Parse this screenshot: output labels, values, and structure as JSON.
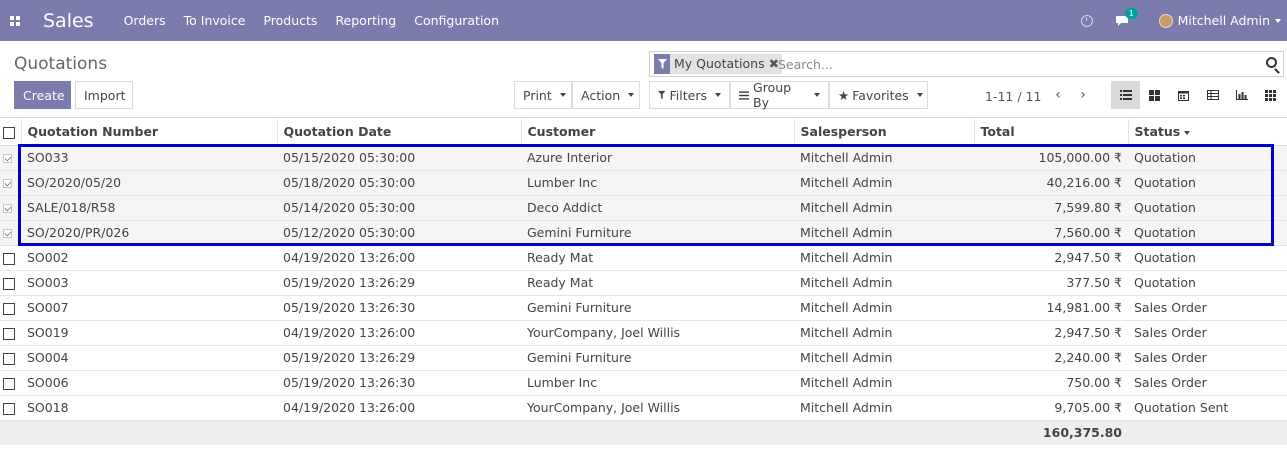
{
  "topbar": {
    "app_name": "Sales",
    "menu": [
      "Orders",
      "To Invoice",
      "Products",
      "Reporting",
      "Configuration"
    ],
    "chat_count": "1",
    "user_name": "Mitchell Admin"
  },
  "control": {
    "title": "Quotations",
    "create_label": "Create",
    "import_label": "Import",
    "print_label": "Print",
    "action_label": "Action",
    "filters_label": "Filters",
    "groupby_label": "Group By",
    "favorites_label": "Favorites",
    "facet_label": "My Quotations",
    "facet_remove": "✖",
    "search_placeholder": "Search...",
    "pager": "1-11 / 11",
    "pager_prev": "‹",
    "pager_next": "›"
  },
  "table": {
    "columns": [
      "Quotation Number",
      "Quotation Date",
      "Customer",
      "Salesperson",
      "Total",
      "Status"
    ],
    "rows": [
      {
        "number": "SO033",
        "date": "05/15/2020 05:30:00",
        "customer": "Azure Interior",
        "salesperson": "Mitchell Admin",
        "total": "105,000.00 ₹",
        "status": "Quotation",
        "checked": true
      },
      {
        "number": "SO/2020/05/20",
        "date": "05/18/2020 05:30:00",
        "customer": "Lumber Inc",
        "salesperson": "Mitchell Admin",
        "total": "40,216.00 ₹",
        "status": "Quotation",
        "checked": true
      },
      {
        "number": "SALE/018/R58",
        "date": "05/14/2020 05:30:00",
        "customer": "Deco Addict",
        "salesperson": "Mitchell Admin",
        "total": "7,599.80 ₹",
        "status": "Quotation",
        "checked": true
      },
      {
        "number": "SO/2020/PR/026",
        "date": "05/12/2020 05:30:00",
        "customer": "Gemini Furniture",
        "salesperson": "Mitchell Admin",
        "total": "7,560.00 ₹",
        "status": "Quotation",
        "checked": true
      },
      {
        "number": "SO002",
        "date": "04/19/2020 13:26:00",
        "customer": "Ready Mat",
        "salesperson": "Mitchell Admin",
        "total": "2,947.50 ₹",
        "status": "Quotation",
        "checked": false
      },
      {
        "number": "SO003",
        "date": "05/19/2020 13:26:29",
        "customer": "Ready Mat",
        "salesperson": "Mitchell Admin",
        "total": "377.50 ₹",
        "status": "Quotation",
        "checked": false
      },
      {
        "number": "SO007",
        "date": "05/19/2020 13:26:30",
        "customer": "Gemini Furniture",
        "salesperson": "Mitchell Admin",
        "total": "14,981.00 ₹",
        "status": "Sales Order",
        "checked": false
      },
      {
        "number": "SO019",
        "date": "04/19/2020 13:26:00",
        "customer": "YourCompany, Joel Willis",
        "salesperson": "Mitchell Admin",
        "total": "2,947.50 ₹",
        "status": "Sales Order",
        "checked": false
      },
      {
        "number": "SO004",
        "date": "05/19/2020 13:26:29",
        "customer": "Gemini Furniture",
        "salesperson": "Mitchell Admin",
        "total": "2,240.00 ₹",
        "status": "Sales Order",
        "checked": false
      },
      {
        "number": "SO006",
        "date": "05/19/2020 13:26:30",
        "customer": "Lumber Inc",
        "salesperson": "Mitchell Admin",
        "total": "750.00 ₹",
        "status": "Sales Order",
        "checked": false
      },
      {
        "number": "SO018",
        "date": "04/19/2020 13:26:00",
        "customer": "YourCompany, Joel Willis",
        "salesperson": "Mitchell Admin",
        "total": "9,705.00 ₹",
        "status": "Quotation Sent",
        "checked": false
      }
    ],
    "footer_total": "160,375.80"
  },
  "colors": {
    "brand": "#7c7bad",
    "highlight_border": "#0000cc",
    "chat_badge": "#00a09d"
  }
}
